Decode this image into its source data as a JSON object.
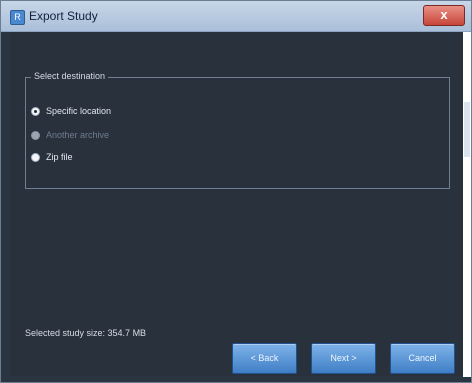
{
  "window": {
    "title": "Export Study",
    "icon": "app-icon",
    "close_label": "x"
  },
  "destination": {
    "group_label": "Select destination",
    "options": [
      {
        "label": "Specific location",
        "checked": true,
        "enabled": true
      },
      {
        "label": "Another archive",
        "checked": false,
        "enabled": false
      },
      {
        "label": "Zip file",
        "checked": false,
        "enabled": true
      }
    ]
  },
  "footer": {
    "study_size": "Selected study size: 354.7 MB",
    "back": "< Back",
    "next": "Next >",
    "cancel": "Cancel"
  }
}
